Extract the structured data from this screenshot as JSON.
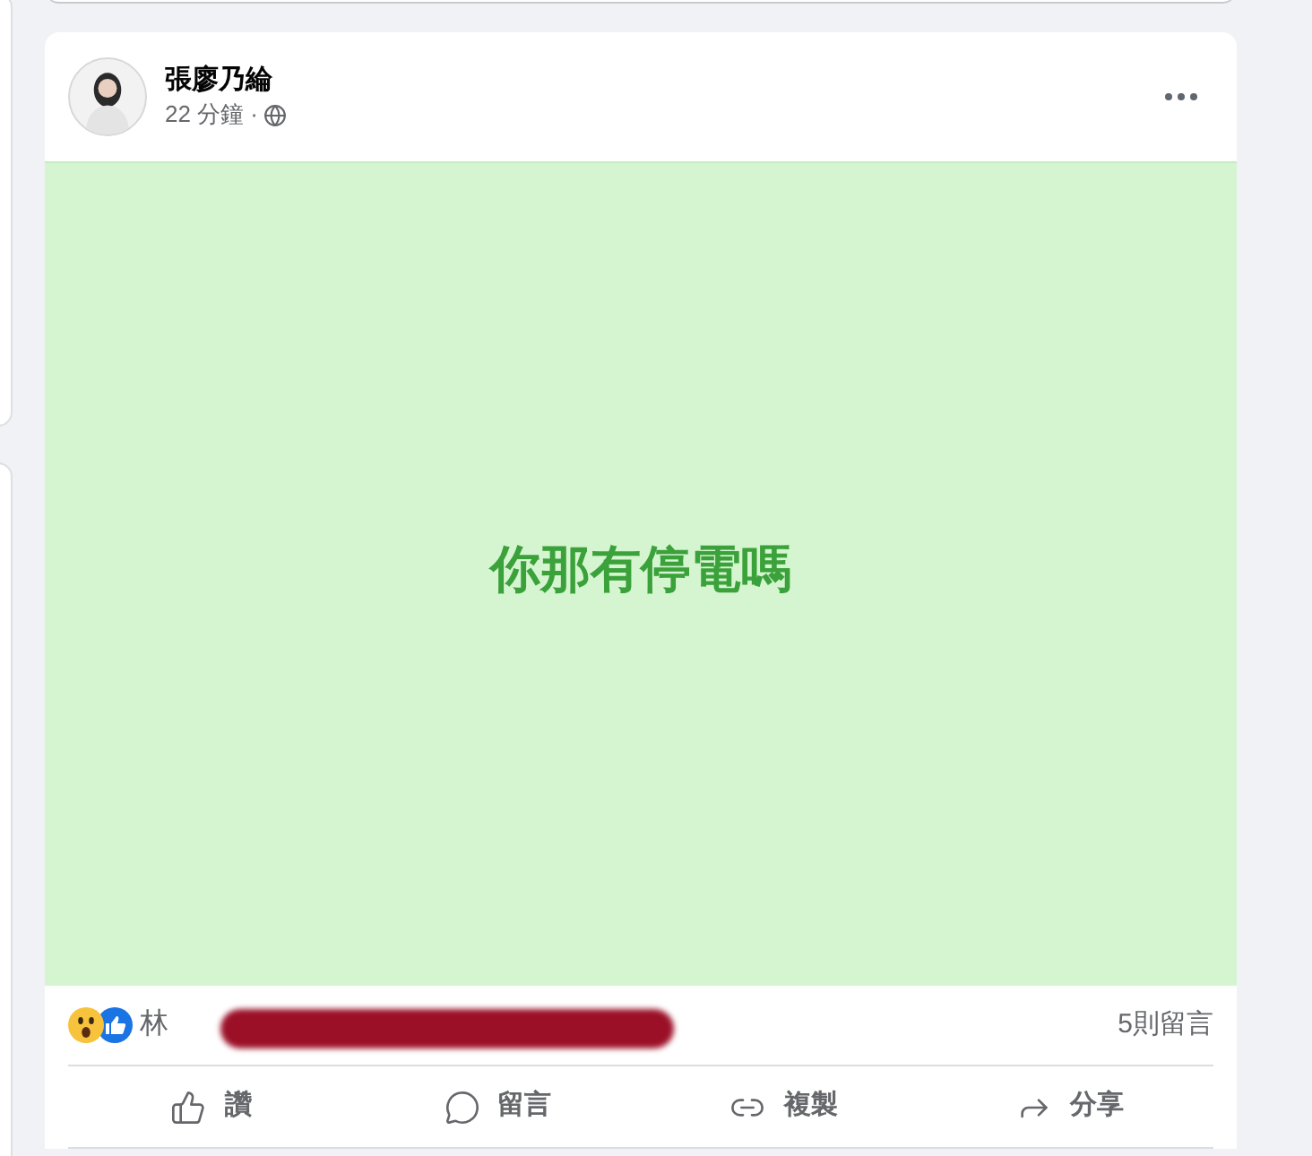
{
  "post": {
    "author": "張廖乃綸",
    "time": "22 分鐘 ·",
    "status_text": "你那有停電嗎",
    "reactor": "林",
    "comments_count": "5則留言"
  },
  "actions": [
    {
      "kind": "like",
      "label": "讚"
    },
    {
      "kind": "comment",
      "label": "留言"
    },
    {
      "kind": "copy",
      "label": "複製"
    },
    {
      "kind": "share",
      "label": "分享"
    }
  ]
}
